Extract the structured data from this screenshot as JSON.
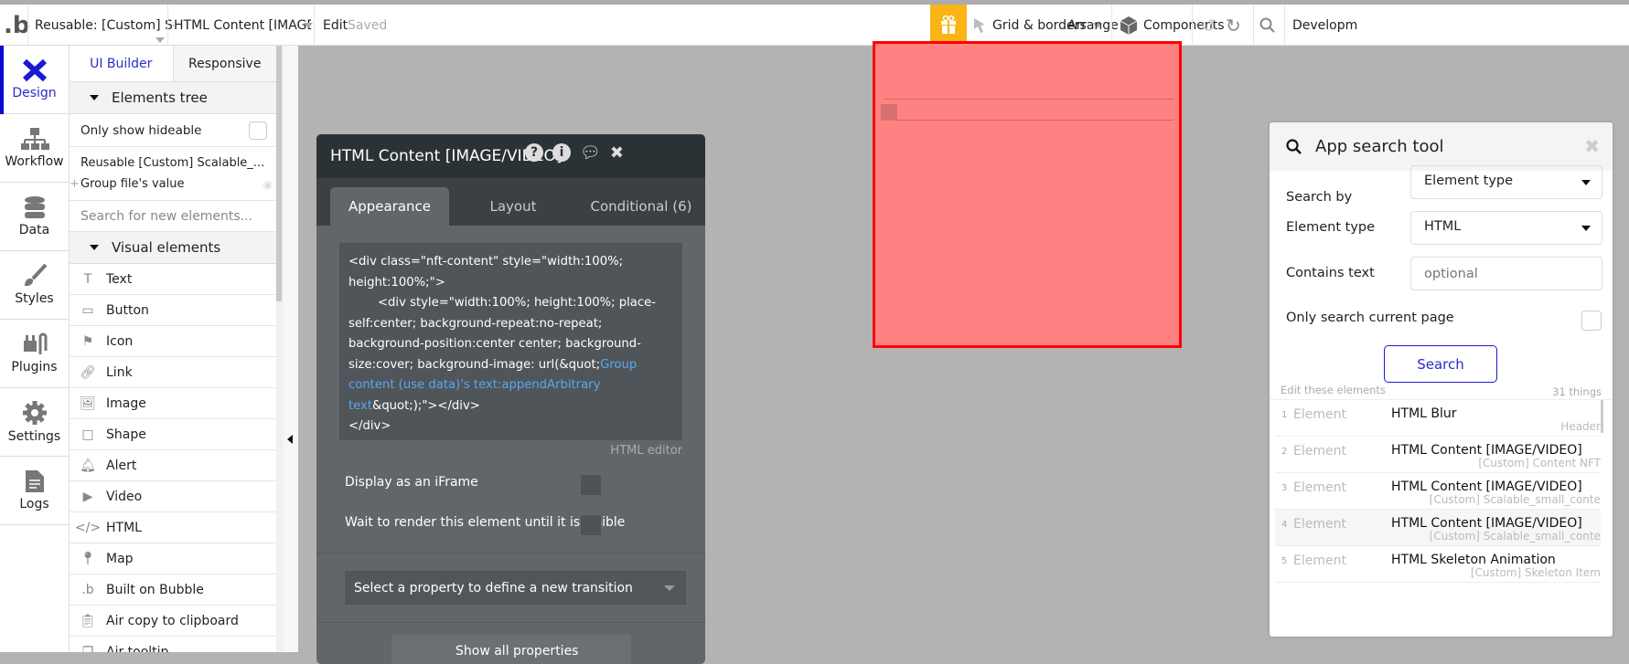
{
  "toolbar": {
    "reusable": "Reusable: [Custom] Scalable_small_cont",
    "element": "HTML Content [IMAGE/VIDEO]",
    "edit": "Edit",
    "saved": "Saved",
    "grid": "Grid & borders",
    "arrange": "Arrange",
    "components": "Components",
    "dev": "Developm",
    "gift_color": "#fbb416"
  },
  "iconbar": [
    "Design",
    "Workflow",
    "Data",
    "Styles",
    "Plugins",
    "Settings",
    "Logs"
  ],
  "panel": {
    "tab_builder": "UI Builder",
    "tab_responsive": "Responsive",
    "elements_tree": "Elements tree",
    "only_hideable": "Only show hideable",
    "reusable_item": "Reusable [Custom] Scalable_...",
    "group_item": "Group file's value",
    "search_placeholder": "Search for new elements...",
    "visual_elements": "Visual elements",
    "items": [
      "Text",
      "Button",
      "Icon",
      "Link",
      "Image",
      "Shape",
      "Alert",
      "Video",
      "HTML",
      "Map",
      "Built on Bubble",
      "Air copy to clipboard",
      "Air tooltip"
    ]
  },
  "html_panel": {
    "title": "HTML Content [IMAGE/VIDEO]",
    "tabs": [
      "Appearance",
      "Layout",
      "Conditional (6)"
    ],
    "code_1": "<div class=\"nft-content\" style=\"width:100%; height:100%;\">",
    "code_2": "<div style=\"width:100%; height:100%; place-self:center; background-repeat:no-repeat; background-position:center center; background-size:cover; background-image: url(&quot;",
    "code_dyn": "Group content (use data)'s text:appendArbitrary text",
    "code_3": "&quot;);\"></div>",
    "code_4": "</div>",
    "editor_label": "HTML editor",
    "iframe": "Display as an iFrame",
    "wait": "Wait to render this element until it is visible",
    "transition": "Select a property to define a new transition",
    "show_all": "Show all properties"
  },
  "search_tool": {
    "title": "App search tool",
    "search_by_label": "Search by",
    "search_by": "Element type",
    "type_label": "Element type",
    "type": "HTML",
    "contains_label": "Contains text",
    "contains_placeholder": "optional",
    "only_page": "Only search current page",
    "search_btn": "Search",
    "edit_these": "Edit these elements",
    "count": "31 things",
    "results": [
      {
        "n": "1",
        "kind": "Element",
        "name": "HTML Blur",
        "parent": "Header"
      },
      {
        "n": "2",
        "kind": "Element",
        "name": "HTML Content [IMAGE/VIDEO]",
        "parent": "[Custom] Content NFT"
      },
      {
        "n": "3",
        "kind": "Element",
        "name": "HTML Content [IMAGE/VIDEO]",
        "parent": "[Custom] Scalable_small_conte"
      },
      {
        "n": "4",
        "kind": "Element",
        "name": "HTML Content [IMAGE/VIDEO]",
        "parent": "[Custom] Scalable_small_conte"
      },
      {
        "n": "5",
        "kind": "Element",
        "name": "HTML Skeleton Animation",
        "parent": "[Custom] Skeleton Item"
      }
    ]
  }
}
